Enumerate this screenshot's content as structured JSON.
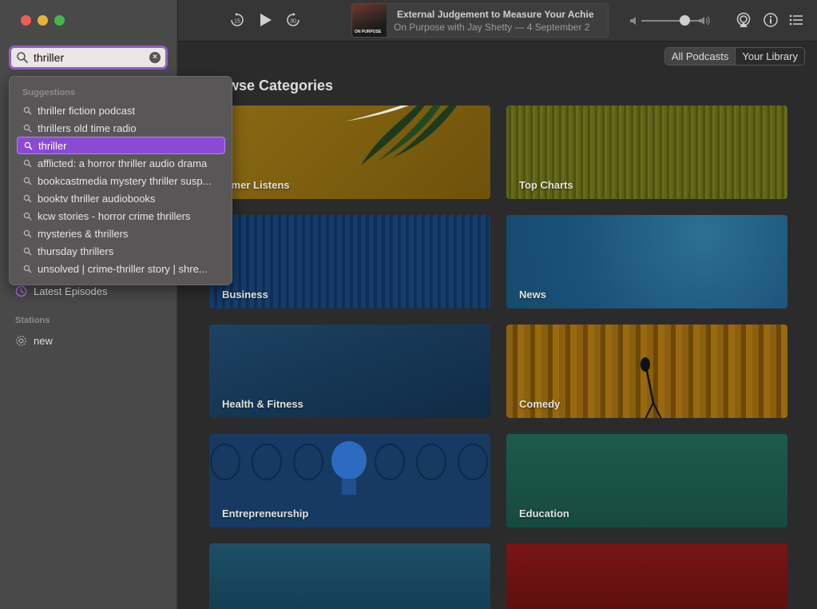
{
  "search": {
    "value": "thriller",
    "clear_glyph": "×"
  },
  "sidebar": {
    "latest_episodes": "Latest Episodes",
    "stations_heading": "Stations",
    "station_new": "new"
  },
  "suggestions": {
    "heading": "Suggestions",
    "items": [
      "thriller fiction podcast",
      "thrillers old time radio",
      "thriller",
      "afflicted: a horror thriller audio drama",
      "bookcastmedia mystery thriller susp...",
      "booktv thriller audiobooks",
      "kcw stories - horror crime thrillers",
      "mysteries & thrillers",
      "thursday thrillers",
      "unsolved | crime-thriller story | shre..."
    ],
    "selected_index": 2
  },
  "now_playing": {
    "title": "External Judgement to Measure Your Achie",
    "subtitle": "On Purpose with Jay Shetty — 4 September 2",
    "artwork_label": "ON PURPOSE",
    "volume_level": 0.75
  },
  "toolbar": {
    "skip_back_seconds": "15",
    "skip_forward_seconds": "30"
  },
  "segments": {
    "all_podcasts": "All Podcasts",
    "your_library": "Your Library"
  },
  "browse": {
    "heading": "wse Categories",
    "tiles": [
      "mmer Listens",
      "Top Charts",
      "Business",
      "News",
      "Health & Fitness",
      "Comedy",
      "Entrepreneurship",
      "Education",
      "",
      ""
    ]
  },
  "colors": {
    "accent": "#8b4ad6",
    "search_ring": "#8f5fc9"
  },
  "icons": [
    "search-icon",
    "clear-icon",
    "clock-icon",
    "gear-icon",
    "skip-back-icon",
    "play-icon",
    "skip-forward-icon",
    "volume-low-icon",
    "volume-high-icon",
    "airplay-icon",
    "info-icon",
    "list-icon"
  ]
}
